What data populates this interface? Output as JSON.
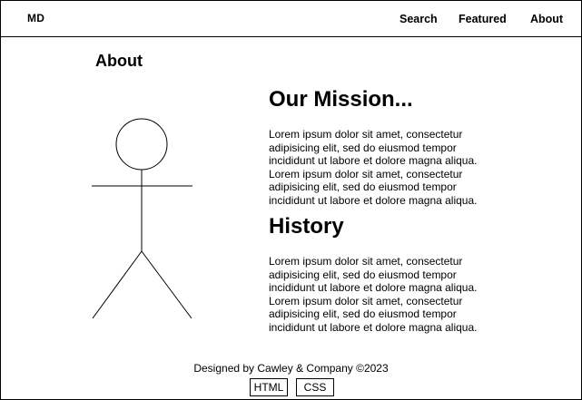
{
  "header": {
    "brand": "MD",
    "nav": {
      "search": "Search",
      "featured": "Featured",
      "about": "About"
    }
  },
  "page": {
    "title": "About"
  },
  "mission": {
    "heading": "Our Mission...",
    "lines": [
      "Lorem ipsum dolor sit amet, consectetur",
      "adipisicing elit, sed do eiusmod tempor",
      "incididunt ut labore et dolore magna aliqua.",
      "Lorem ipsum dolor sit amet, consectetur",
      "adipisicing elit, sed do eiusmod tempor",
      "incididunt ut labore et dolore magna aliqua."
    ]
  },
  "history": {
    "heading": "History",
    "lines": [
      "Lorem ipsum dolor sit amet, consectetur",
      "adipisicing elit, sed do eiusmod tempor",
      "incididunt ut labore et dolore magna aliqua.",
      "Lorem ipsum dolor sit amet, consectetur",
      "adipisicing elit, sed do eiusmod tempor",
      "incididunt ut labore et dolore magna aliqua."
    ]
  },
  "footer": {
    "credit": "Designed by Cawley & Company ©2023",
    "badges": {
      "html": "HTML",
      "css": "CSS"
    }
  }
}
